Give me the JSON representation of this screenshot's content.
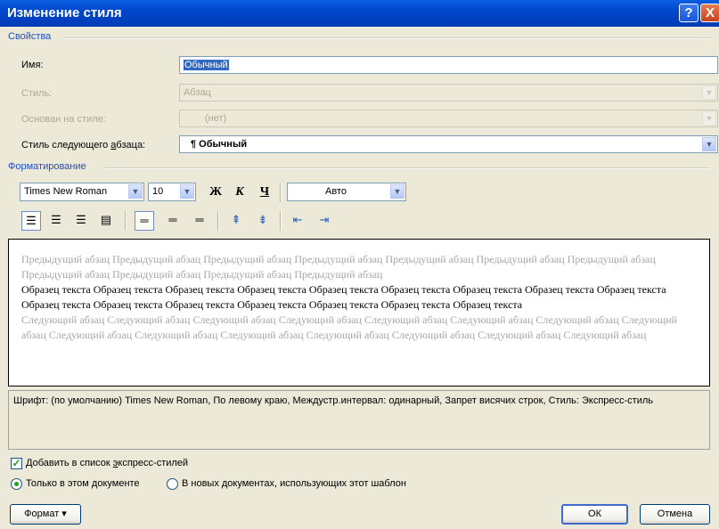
{
  "window": {
    "title": "Изменение стиля",
    "help": "?",
    "close": "X"
  },
  "properties": {
    "section": "Свойства",
    "name_label": "Имя:",
    "name_value": "Обычный",
    "style_label": "Стиль:",
    "style_value": "Абзац",
    "based_on_label": "Основан на стиле:",
    "based_on_value": "(нет)",
    "next_label": "Стиль следующего абзаца:",
    "next_value": "¶ Обычный"
  },
  "formatting": {
    "section": "Форматирование",
    "font": "Times New Roman",
    "size": "10",
    "bold": "Ж",
    "italic": "К",
    "underline": "Ч",
    "color": "Авто"
  },
  "preview": {
    "previous": "Предыдущий абзац Предыдущий абзац Предыдущий абзац Предыдущий абзац Предыдущий абзац Предыдущий абзац Предыдущий абзац Предыдущий абзац Предыдущий абзац Предыдущий абзац Предыдущий абзац",
    "sample": "Образец текста Образец текста Образец текста Образец текста Образец текста Образец текста Образец текста Образец текста Образец текста Образец текста Образец текста Образец текста Образец текста Образец текста Образец текста Образец текста",
    "next": "Следующий абзац Следующий абзац Следующий абзац Следующий абзац Следующий абзац Следующий абзац Следующий абзац Следующий абзац Следующий абзац Следующий абзац Следующий абзац Следующий абзац Следующий абзац Следующий абзац Следующий абзац"
  },
  "description": "Шрифт: (по умолчанию) Times New Roman, По левому краю, Междустр.интервал:  одинарный, Запрет висячих строк, Стиль: Экспресс-стиль",
  "options": {
    "add_quick": "Добавить в список экспресс-стилей",
    "only_doc": "Только в этом документе",
    "new_docs": "В новых документах, использующих этот шаблон"
  },
  "buttons": {
    "format": "Формат ▾",
    "ok": "ОК",
    "cancel": "Отмена"
  },
  "colors": {
    "accent": "#1f4fc4",
    "titlebar": "#0047cc",
    "background": "#ece9d8"
  }
}
